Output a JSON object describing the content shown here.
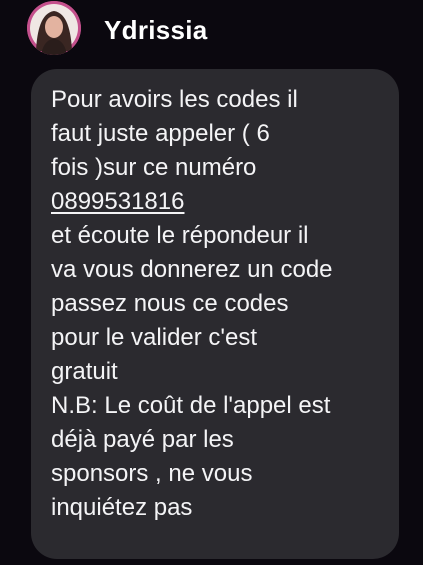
{
  "sender": {
    "name": "Ydrissia",
    "avatar_icon": "profile-photo-avatar",
    "avatar_color": "#c4508c"
  },
  "message": {
    "text_before": "Pour avoirs les codes il\nfaut juste appeler ( 6\nfois )sur ce numéro\n",
    "phone_number": "0899531816",
    "text_after": "\n et écoute le répondeur il\nva vous donnerez un code\npassez nous ce codes\npour le valider c'est\ngratuit\nN.B: Le coût de l'appel est\ndéjà payé par les\nsponsors , ne vous\ninquiétez pas",
    "bubble_color": "#2b2a2f"
  }
}
